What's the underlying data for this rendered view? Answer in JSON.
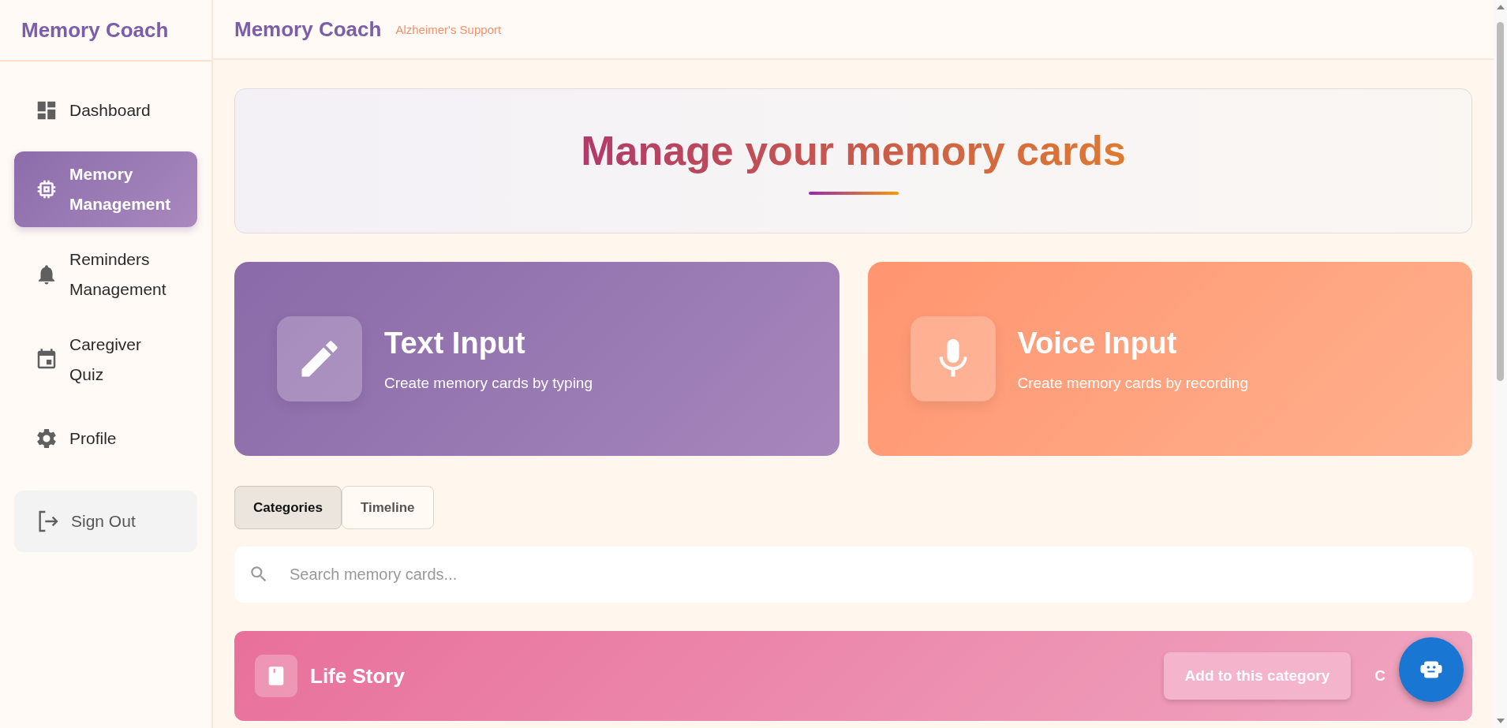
{
  "sidebar": {
    "brand": "Memory Coach",
    "items": [
      {
        "label": "Dashboard",
        "selected": false
      },
      {
        "label": "Memory Management",
        "selected": true
      },
      {
        "label": "Reminders Management",
        "selected": false
      },
      {
        "label": "Caregiver Quiz",
        "selected": false
      },
      {
        "label": "Profile",
        "selected": false
      }
    ],
    "sign_out": "Sign Out"
  },
  "header": {
    "title": "Memory Coach",
    "subtitle": "Alzheimer's Support"
  },
  "hero": {
    "title": "Manage your memory cards"
  },
  "input_options": [
    {
      "kind": "text",
      "title": "Text Input",
      "description": "Create memory cards by typing"
    },
    {
      "kind": "voice",
      "title": "Voice Input",
      "description": "Create memory cards by recording"
    }
  ],
  "view_tabs": [
    {
      "label": "Categories",
      "selected": true
    },
    {
      "label": "Timeline",
      "selected": false
    }
  ],
  "search": {
    "placeholder": "Search memory cards..."
  },
  "categories": [
    {
      "name": "Life Story",
      "action": "Add to this category",
      "column_3": "C"
    }
  ]
}
